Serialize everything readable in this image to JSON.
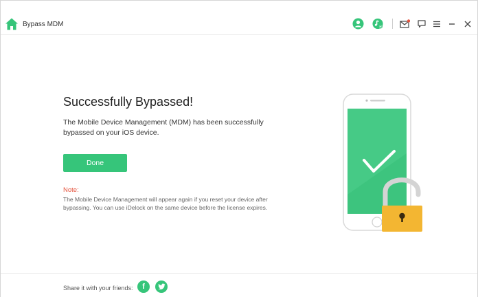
{
  "window": {
    "title": "Bypass MDM"
  },
  "toolbar": {
    "icons": [
      "account-icon",
      "music-search-icon",
      "mail-icon",
      "feedback-icon",
      "menu-icon",
      "minimize-icon",
      "close-icon"
    ]
  },
  "main": {
    "heading": "Successfully Bypassed!",
    "description": "The Mobile Device Management (MDM) has been successfully bypassed on your iOS device.",
    "done_label": "Done",
    "note_label": "Note:",
    "note_text": "The Mobile Device Management will appear again if you reset your device after bypassing. You can use iDelock on the same device before the license expires."
  },
  "footer": {
    "share_text": "Share it with your friends:",
    "facebook_glyph": "f"
  },
  "colors": {
    "accent": "#36c57a",
    "note": "#e5533d",
    "lock": "#f3b632"
  }
}
